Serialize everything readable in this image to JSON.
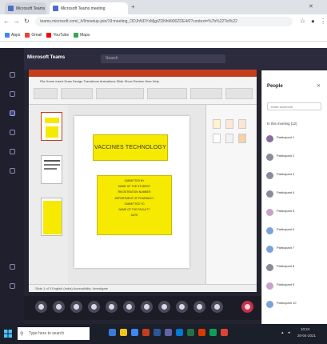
{
  "browser": {
    "tabs": [
      {
        "label": "Microsoft Teams"
      },
      {
        "label": "Microsoft Teams meeting"
      }
    ],
    "address": "teams.microsoft.com/_#/l/meetup-join/19:meeting_ODJhNDYzMjgtZDNhMi00ZDE4/0?context=%7b%22Tid%22",
    "bookmarks": [
      "Apps",
      "Gmail",
      "YouTube",
      "Maps"
    ]
  },
  "teams": {
    "app_title": "Microsoft Teams",
    "search_placeholder": "Search"
  },
  "ppt": {
    "ribbon_tabs": "File   Home   Insert   Draw   Design   Transitions   Animations   Slide Show   Review   View   Help",
    "status": "Slide 1 of 3      English (India)      Accessibility: Investigate"
  },
  "slide": {
    "title": "VACCINES TECHNOLOGY",
    "body_lines": [
      "SUBMITTED BY",
      "NAME OF THE STUDENT",
      "REGISTRATION NUMBER",
      "DEPARTMENT OF PHARMACY",
      "SUBMITTED TO",
      "NAME OF THE FACULTY",
      "DATE"
    ]
  },
  "people": {
    "title": "People",
    "search_placeholder": "Invite someone",
    "section_label": "In this meeting (12)",
    "participants": [
      {
        "name": "Participant 1",
        "sub": ""
      },
      {
        "name": "Participant 2",
        "sub": ""
      },
      {
        "name": "Participant 3",
        "sub": ""
      },
      {
        "name": "Participant 4",
        "sub": ""
      },
      {
        "name": "Participant 5",
        "sub": ""
      },
      {
        "name": "Participant 6",
        "sub": ""
      },
      {
        "name": "Participant 7",
        "sub": ""
      },
      {
        "name": "Participant 8",
        "sub": ""
      },
      {
        "name": "Participant 9",
        "sub": ""
      },
      {
        "name": "Participant 10",
        "sub": ""
      }
    ]
  },
  "taskbar": {
    "search_placeholder": "Type here to search",
    "time": "10:24",
    "date": "20-04-2021"
  },
  "colors": {
    "slide_accent": "#f6ea00",
    "ppt_brand": "#c43e1c",
    "teams_dark": "#2b2b3d",
    "leave_red": "#c4314b"
  }
}
